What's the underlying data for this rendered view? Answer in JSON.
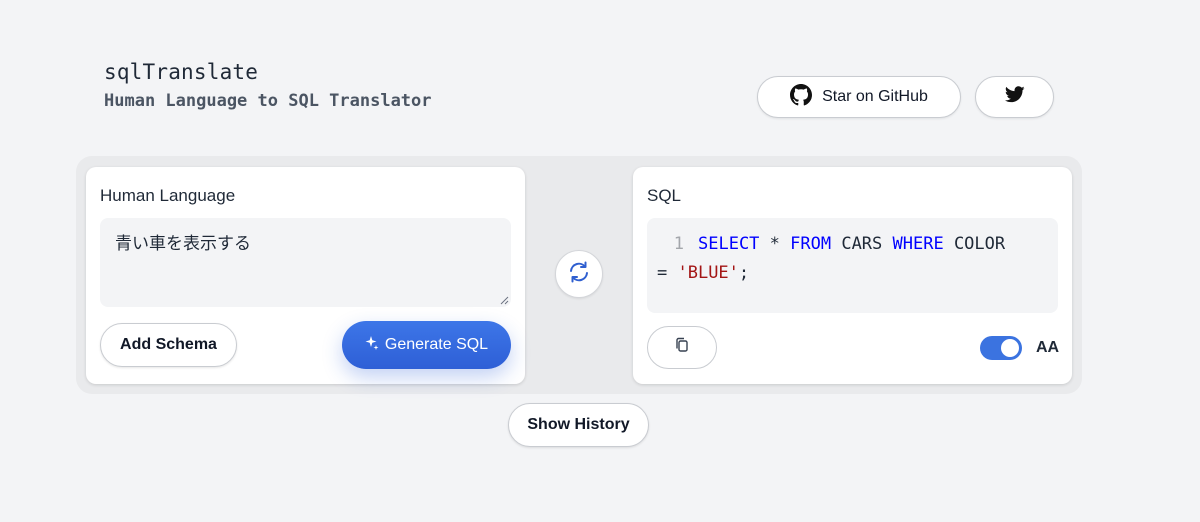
{
  "brand": {
    "title": "sqlTranslate",
    "subtitle": "Human Language to SQL Translator"
  },
  "header": {
    "github_label": "Star on GitHub",
    "github_icon": "github-icon",
    "twitter_icon": "twitter-icon"
  },
  "human_panel": {
    "label": "Human Language",
    "input_value": "青い車を表示する",
    "add_schema_label": "Add Schema",
    "generate_label": "Generate SQL",
    "generate_icon": "sparkle-icon"
  },
  "swap": {
    "icon": "swap-arrows-icon"
  },
  "sql_panel": {
    "label": "SQL",
    "line_number": "1",
    "code_tokens": {
      "select": "SELECT",
      "star": " * ",
      "from": "FROM",
      "cars": " CARS ",
      "where": "WHERE",
      "color": " COLOR",
      "eq": "= ",
      "blue": "'BLUE'",
      "semi": ";"
    },
    "copy_icon": "copy-icon",
    "toggle_on": true,
    "toggle_label": "AA"
  },
  "footer": {
    "history_label": "Show History"
  },
  "colors": {
    "accent": "#3b73e0",
    "keyword": "#0000ff",
    "string": "#a31515",
    "background": "#f3f4f6"
  }
}
